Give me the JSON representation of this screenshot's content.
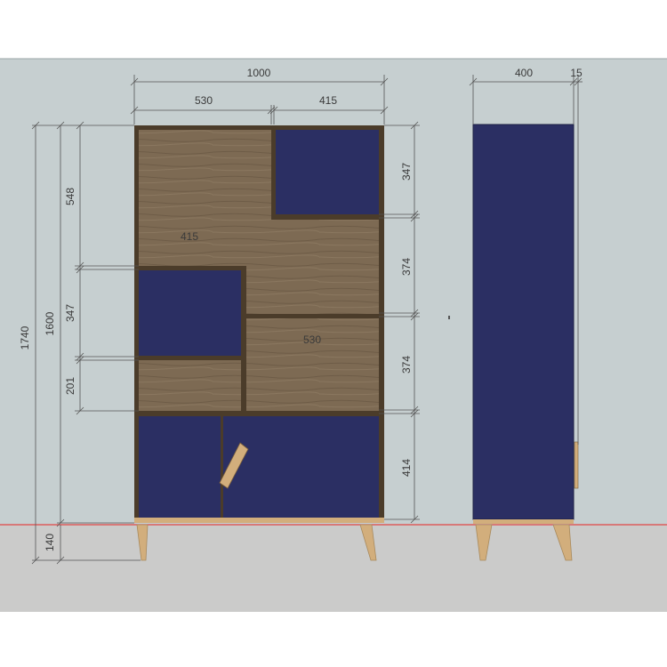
{
  "colors": {
    "wall": "#c6cfd0",
    "floor": "#cbcbca",
    "navy": "#2b2f63",
    "wood": "#7d6a53",
    "frame": "#4b3c2a",
    "leg": "#d2ae7c",
    "floor_line": "#e04646",
    "dim_line": "#555555"
  },
  "front_view": {
    "overall_width": "1000",
    "left_width": "530",
    "right_width": "415",
    "inner_label_upper": "415",
    "inner_label_lower": "530",
    "height_total": "1740",
    "height_body": "1600",
    "height_548": "548",
    "height_347_left": "347",
    "height_201": "201",
    "height_legs": "140",
    "right_347": "347",
    "right_374_a": "374",
    "right_374_b": "374",
    "right_414": "414"
  },
  "side_view": {
    "depth": "400",
    "back_offset": "15"
  }
}
